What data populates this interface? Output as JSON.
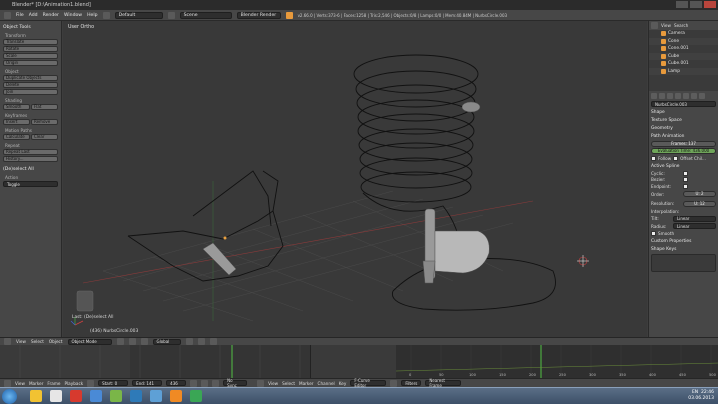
{
  "window": {
    "title": "Blender* [D:\\Animation1.blend]"
  },
  "infobar": {
    "menus": [
      "File",
      "Add",
      "Render",
      "Window",
      "Help"
    ],
    "layout": "Default",
    "scene": "Scene",
    "engine": "Blender Render",
    "stats": "v2.66.0 | Verts:373-6 | Faces:1258 | Tris:2,546 | Objects:0/8 | Lamps:0/0 | Mem:40.84M | NurbsCircle.003"
  },
  "toolshelf": {
    "title": "Object Tools",
    "transform": {
      "label": "Transform",
      "buttons": [
        "Translate",
        "Rotate",
        "Scale",
        "Origin"
      ]
    },
    "object": {
      "label": "Object",
      "buttons": [
        "Duplicate Objects",
        "Delete",
        "Join"
      ]
    },
    "shading": {
      "label": "Shading",
      "smooth": "Smooth",
      "flat": "Flat"
    },
    "keyframes": {
      "label": "Keyframes",
      "insert": "Insert",
      "remove": "Remove"
    },
    "motion_paths": {
      "label": "Motion Paths",
      "calculate": "Calculate",
      "clear": "Clear"
    },
    "repeat": {
      "label": "Repeat",
      "buttons": [
        "Repeat Last",
        "History..."
      ]
    },
    "last_op": {
      "label": "(De)select All",
      "action_label": "Action",
      "action_value": "Toggle"
    }
  },
  "viewport": {
    "label": "User Ortho",
    "last_operator": "Last: (De)select All",
    "object_name": "(436) NurbsCircle.003"
  },
  "outliner": {
    "header": [
      "View",
      "Search"
    ],
    "items": [
      "Camera",
      "Cone",
      "Cone.001",
      "Cube",
      "Cube.001",
      "Lamp"
    ]
  },
  "properties": {
    "object_name": "NurbsCircle.003",
    "sections": [
      "Shape",
      "Texture Space",
      "Geometry"
    ],
    "path_animation": {
      "label": "Path Animation",
      "frames": "Frames: 137",
      "eval_time": "Evaluation Time: 436.000",
      "follow": "Follow",
      "offset": "Offset Chil..."
    },
    "active_spline": {
      "label": "Active Spline",
      "cyclic": "Cyclic:",
      "bezier": "Bezier:",
      "endpoint": "Endpoint:",
      "order": "Order:",
      "order_val": "U: 2",
      "resolution": "Resolution:",
      "resolution_val": "U: 12",
      "interpolation": "Interpolation:",
      "tilt": "Tilt:",
      "tilt_val": "Linear",
      "radius": "Radius:",
      "radius_val": "Linear",
      "smooth": "Smooth"
    },
    "custom_properties": "Custom Properties",
    "shape_keys": "Shape Keys"
  },
  "view3d_header": {
    "menus": [
      "View",
      "Select",
      "Object"
    ],
    "mode": "Object Mode",
    "pivot": "Global"
  },
  "timeline_header": {
    "menus": [
      "View",
      "Marker",
      "Frame",
      "Playback"
    ],
    "start": "Start: 0",
    "end": "End: 141",
    "current": "436",
    "sync": "No Sync"
  },
  "graph_header": {
    "menus": [
      "View",
      "Select",
      "Marker",
      "Channel",
      "Key"
    ],
    "editor": "F-Curve Editor",
    "filters": "Filters",
    "pivot": "Nearest Frame"
  },
  "graph_ticks": [
    "0",
    "50",
    "100",
    "150",
    "200",
    "250",
    "300",
    "350",
    "400",
    "450",
    "500"
  ],
  "tray": {
    "time": "22:46",
    "date": "03.06.2013",
    "lang": "EN"
  },
  "colors": {
    "accent": "#e89a3c",
    "green_field": "#6fa55a",
    "frame_line": "#52c043"
  }
}
